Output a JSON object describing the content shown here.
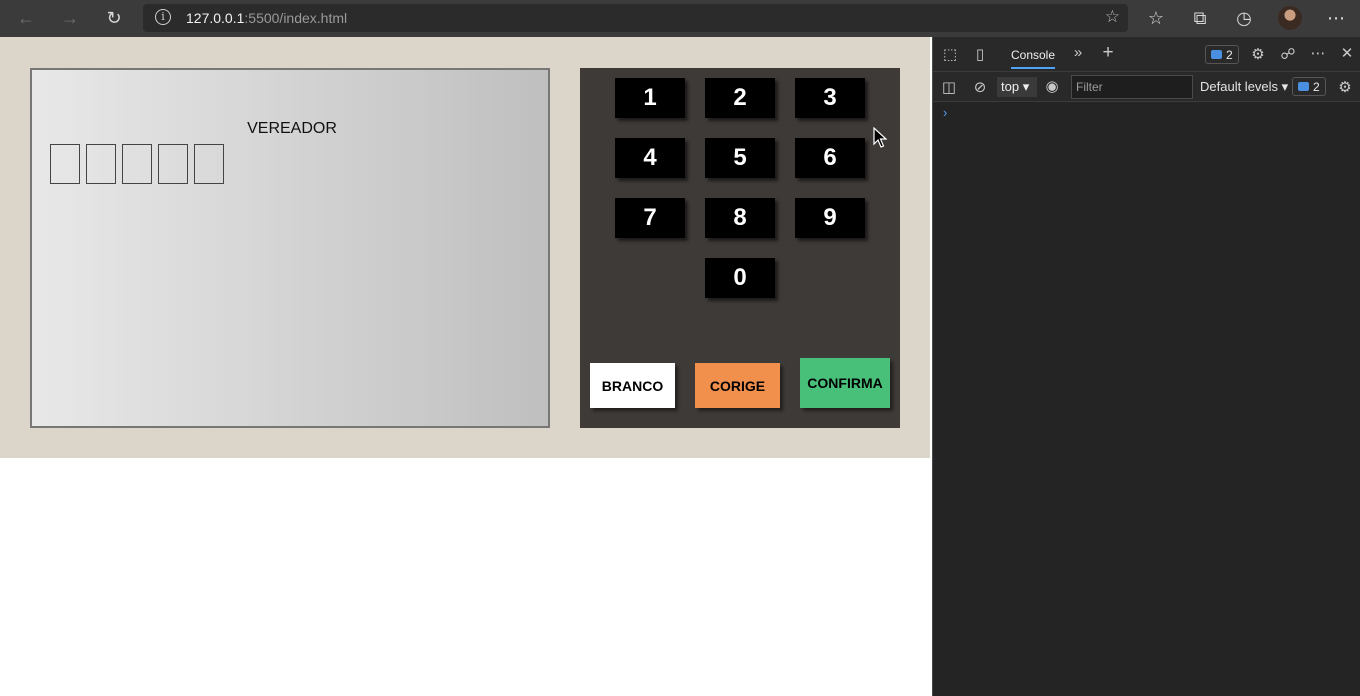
{
  "browser": {
    "url_host": "127.0.0.1",
    "url_path": ":5500/index.html"
  },
  "screen": {
    "role_title": "VEREADOR",
    "digit_boxes": [
      "",
      "",
      "",
      "",
      ""
    ]
  },
  "keypad": {
    "keys": [
      "1",
      "2",
      "3",
      "4",
      "5",
      "6",
      "7",
      "8",
      "9",
      "0"
    ],
    "branco_label": "BRANCO",
    "corrige_label": "CORIGE",
    "confirma_label": "CONFIRMA"
  },
  "devtools": {
    "console_tab": "Console",
    "issues_count": "2",
    "context": "top",
    "filter_placeholder": "Filter",
    "levels_label": "Default levels",
    "messages_count": "2"
  },
  "colors": {
    "page_bg": "#dcd5ca",
    "keypad_bg": "#3e3a38",
    "branco": "#ffffff",
    "corrige": "#f0904c",
    "confirma": "#48c07a"
  }
}
